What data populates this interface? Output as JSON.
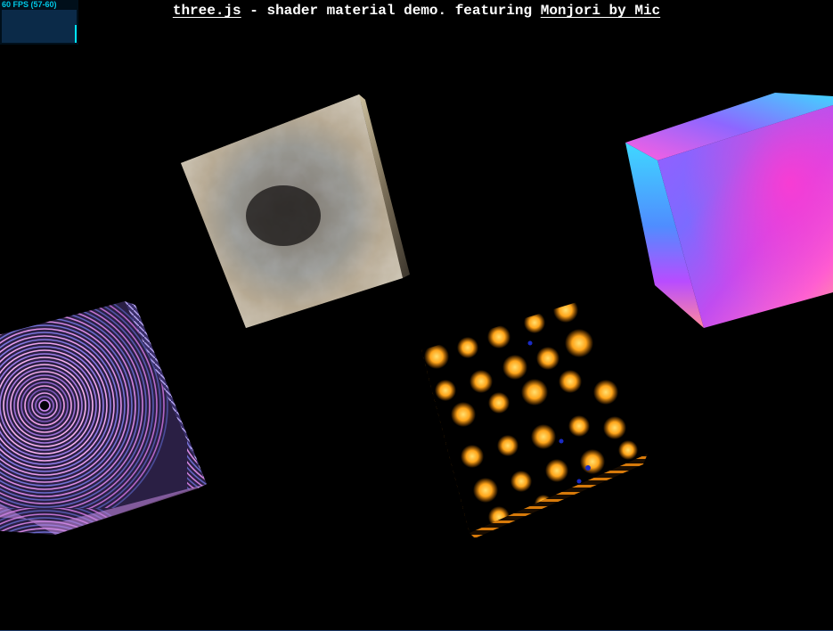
{
  "header": {
    "link_threejs": "three.js",
    "middle_text": " - shader material demo. featuring ",
    "link_monjori": "Monjori by Mic"
  },
  "stats": {
    "fps_text": "60 FPS (57-60)",
    "fps_level": 0.55
  },
  "colors": {
    "background": "#000000",
    "text": "#ffffff",
    "stats_text": "#00c8e6",
    "stats_graph_bg": "#0b2a48",
    "stats_bar": "#00e5ff"
  },
  "scene": {
    "cubes": [
      {
        "shader": "stone-cloud",
        "palette": [
          "#3c4a52",
          "#8a7355",
          "#c9b89a",
          "#1c1a18"
        ]
      },
      {
        "shader": "normal-gradient",
        "palette": [
          "#ff4fd8",
          "#9a4cff",
          "#5a7dff",
          "#3fd0ff",
          "#ff9c9c"
        ]
      },
      {
        "shader": "ripple-moire",
        "palette": [
          "#1e1733",
          "#b67be0",
          "#f08de6",
          "#6a4fa7"
        ]
      },
      {
        "shader": "fire-blobs",
        "palette": [
          "#000000",
          "#ff9a10",
          "#ffd04a",
          "#1020a0"
        ]
      }
    ]
  }
}
